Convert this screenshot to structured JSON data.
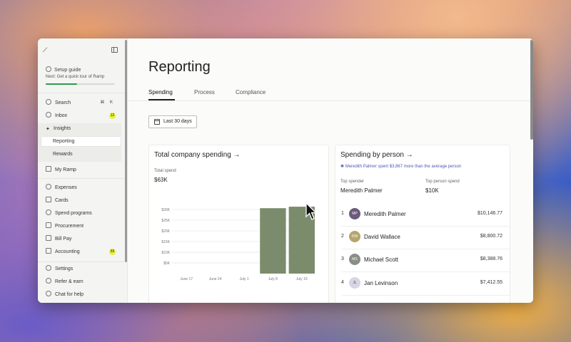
{
  "sidebar": {
    "setup_title": "Setup guide",
    "setup_sub": "Next: Get a quick tour of Ramp",
    "setup_progress": 0.45,
    "search": {
      "label": "Search",
      "shortcut": "⌘ K"
    },
    "inbox": {
      "label": "Inbox",
      "badge": "12"
    },
    "insights": {
      "label": "Insights"
    },
    "reporting": {
      "label": "Reporting"
    },
    "rewards": {
      "label": "Rewards"
    },
    "my_ramp": {
      "label": "My Ramp"
    },
    "expenses": {
      "label": "Expenses"
    },
    "cards": {
      "label": "Cards"
    },
    "spend_programs": {
      "label": "Spend programs"
    },
    "procurement": {
      "label": "Procurement"
    },
    "bill_pay": {
      "label": "Bill Pay"
    },
    "accounting": {
      "label": "Accounting",
      "badge": "69"
    },
    "settings": {
      "label": "Settings"
    },
    "refer": {
      "label": "Refer & earn"
    },
    "chat": {
      "label": "Chat for help"
    }
  },
  "main": {
    "title": "Reporting",
    "tabs": [
      "Spending",
      "Process",
      "Compliance"
    ],
    "date_filter": "Last 30 days",
    "total_card": {
      "title": "Total company spending →",
      "total_label": "Total spend",
      "total_value": "$63K"
    },
    "person_card": {
      "title": "Spending by person →",
      "insight": "Meredith Palmer spent $3,867 more than the average person",
      "top_spender_label": "Top spender",
      "top_spender_value": "Meredith Palmer",
      "top_person_spend_label": "Top person spend",
      "top_person_spend_value": "$10K",
      "people": [
        {
          "rank": "1",
          "initials": "MP",
          "name": "Meredith Palmer",
          "amount": "$10,146.77",
          "color": "#6b5a7a"
        },
        {
          "rank": "2",
          "initials": "DW",
          "name": "David Wallace",
          "amount": "$8,800.72",
          "color": "#b6a56b"
        },
        {
          "rank": "3",
          "initials": "MS",
          "name": "Michael Scott",
          "amount": "$8,388.76",
          "color": "#8a8f86"
        },
        {
          "rank": "4",
          "initials": "JL",
          "name": "Jan Levinson",
          "amount": "$7,412.55",
          "color": "#d9d4e6"
        }
      ]
    }
  },
  "chart_data": {
    "type": "bar",
    "categories": [
      "June 17",
      "June 24",
      "July 1",
      "July 8",
      "July 15"
    ],
    "values": [
      0,
      0,
      0,
      30600,
      31300
    ],
    "ylim": [
      0,
      32000
    ],
    "yticks": [
      "$5K",
      "$10K",
      "$15K",
      "$20K",
      "$25K",
      "$30K"
    ],
    "ytick_values": [
      5000,
      10000,
      15000,
      20000,
      25000,
      30000
    ],
    "bar_color": "#7b8c6c",
    "grid": true
  }
}
